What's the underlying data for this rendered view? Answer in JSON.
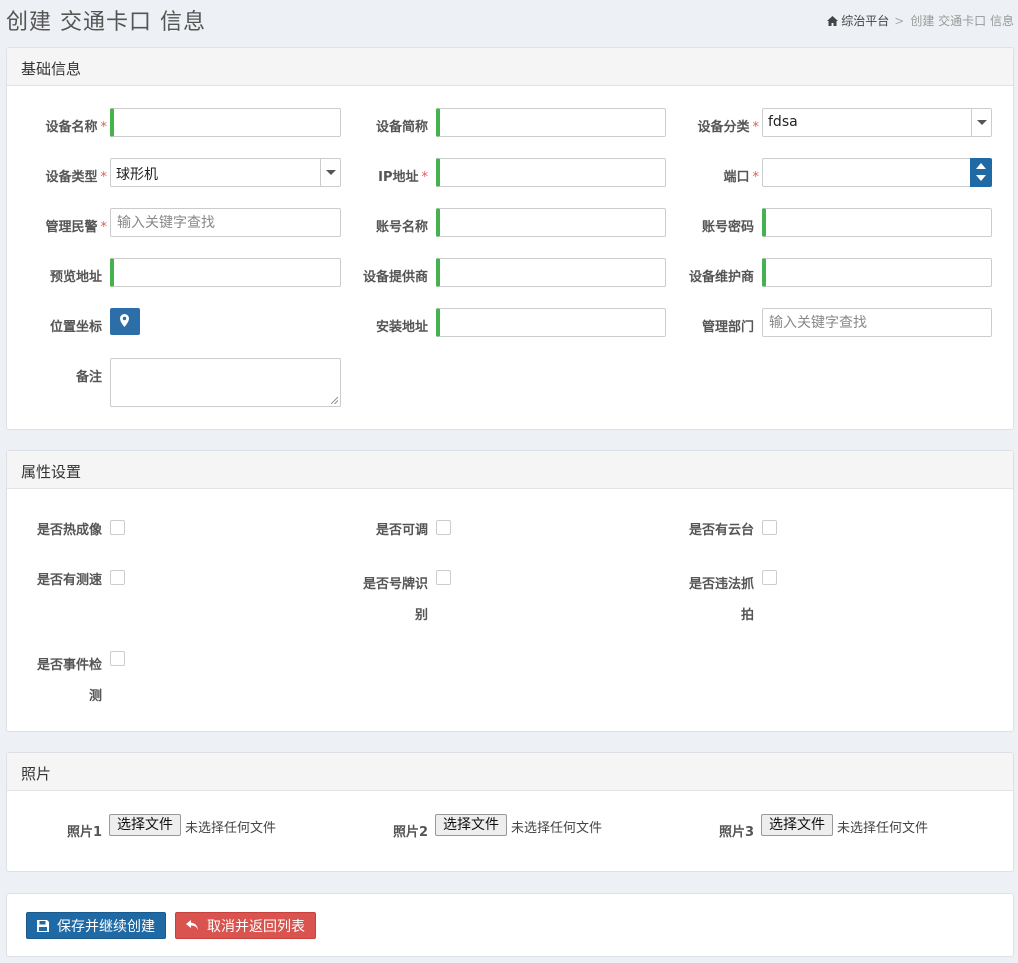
{
  "header": {
    "title": "创建 交通卡口 信息",
    "breadcrumb_home": "综治平台",
    "breadcrumb_sep": ">",
    "breadcrumb_current": "创建 交通卡口 信息"
  },
  "basic": {
    "heading": "基础信息",
    "required_mark": "*",
    "device_name_label": "设备名称",
    "device_short_label": "设备简称",
    "device_category_label": "设备分类",
    "device_category_value": "fdsa",
    "device_type_label": "设备类型",
    "device_type_value": "球形机",
    "ip_label": "IP地址",
    "port_label": "端口",
    "police_label": "管理民警",
    "police_placeholder": "输入关键字查找",
    "account_name_label": "账号名称",
    "account_pwd_label": "账号密码",
    "preview_label": "预览地址",
    "provider_label": "设备提供商",
    "maintainer_label": "设备维护商",
    "location_label": "位置坐标",
    "install_addr_label": "安装地址",
    "dept_label": "管理部门",
    "dept_placeholder": "输入关键字查找",
    "remark_label": "备注"
  },
  "attrs": {
    "heading": "属性设置",
    "thermal_label": "是否热成像",
    "adjustable_label": "是否可调",
    "ptz_label": "是否有云台",
    "speed_label": "是否有测速",
    "plate_label_1": "是否号牌识",
    "plate_label_2": "别",
    "violation_label_1": "是否违法抓",
    "violation_label_2": "拍",
    "event_label_1": "是否事件检",
    "event_label_2": "测"
  },
  "photos": {
    "heading": "照片",
    "photo1_label": "照片1",
    "photo2_label": "照片2",
    "photo3_label": "照片3",
    "choose_btn": "选择文件",
    "no_file": "未选择任何文件"
  },
  "actions": {
    "save_label": "保存并继续创建",
    "cancel_label": "取消并返回列表"
  }
}
